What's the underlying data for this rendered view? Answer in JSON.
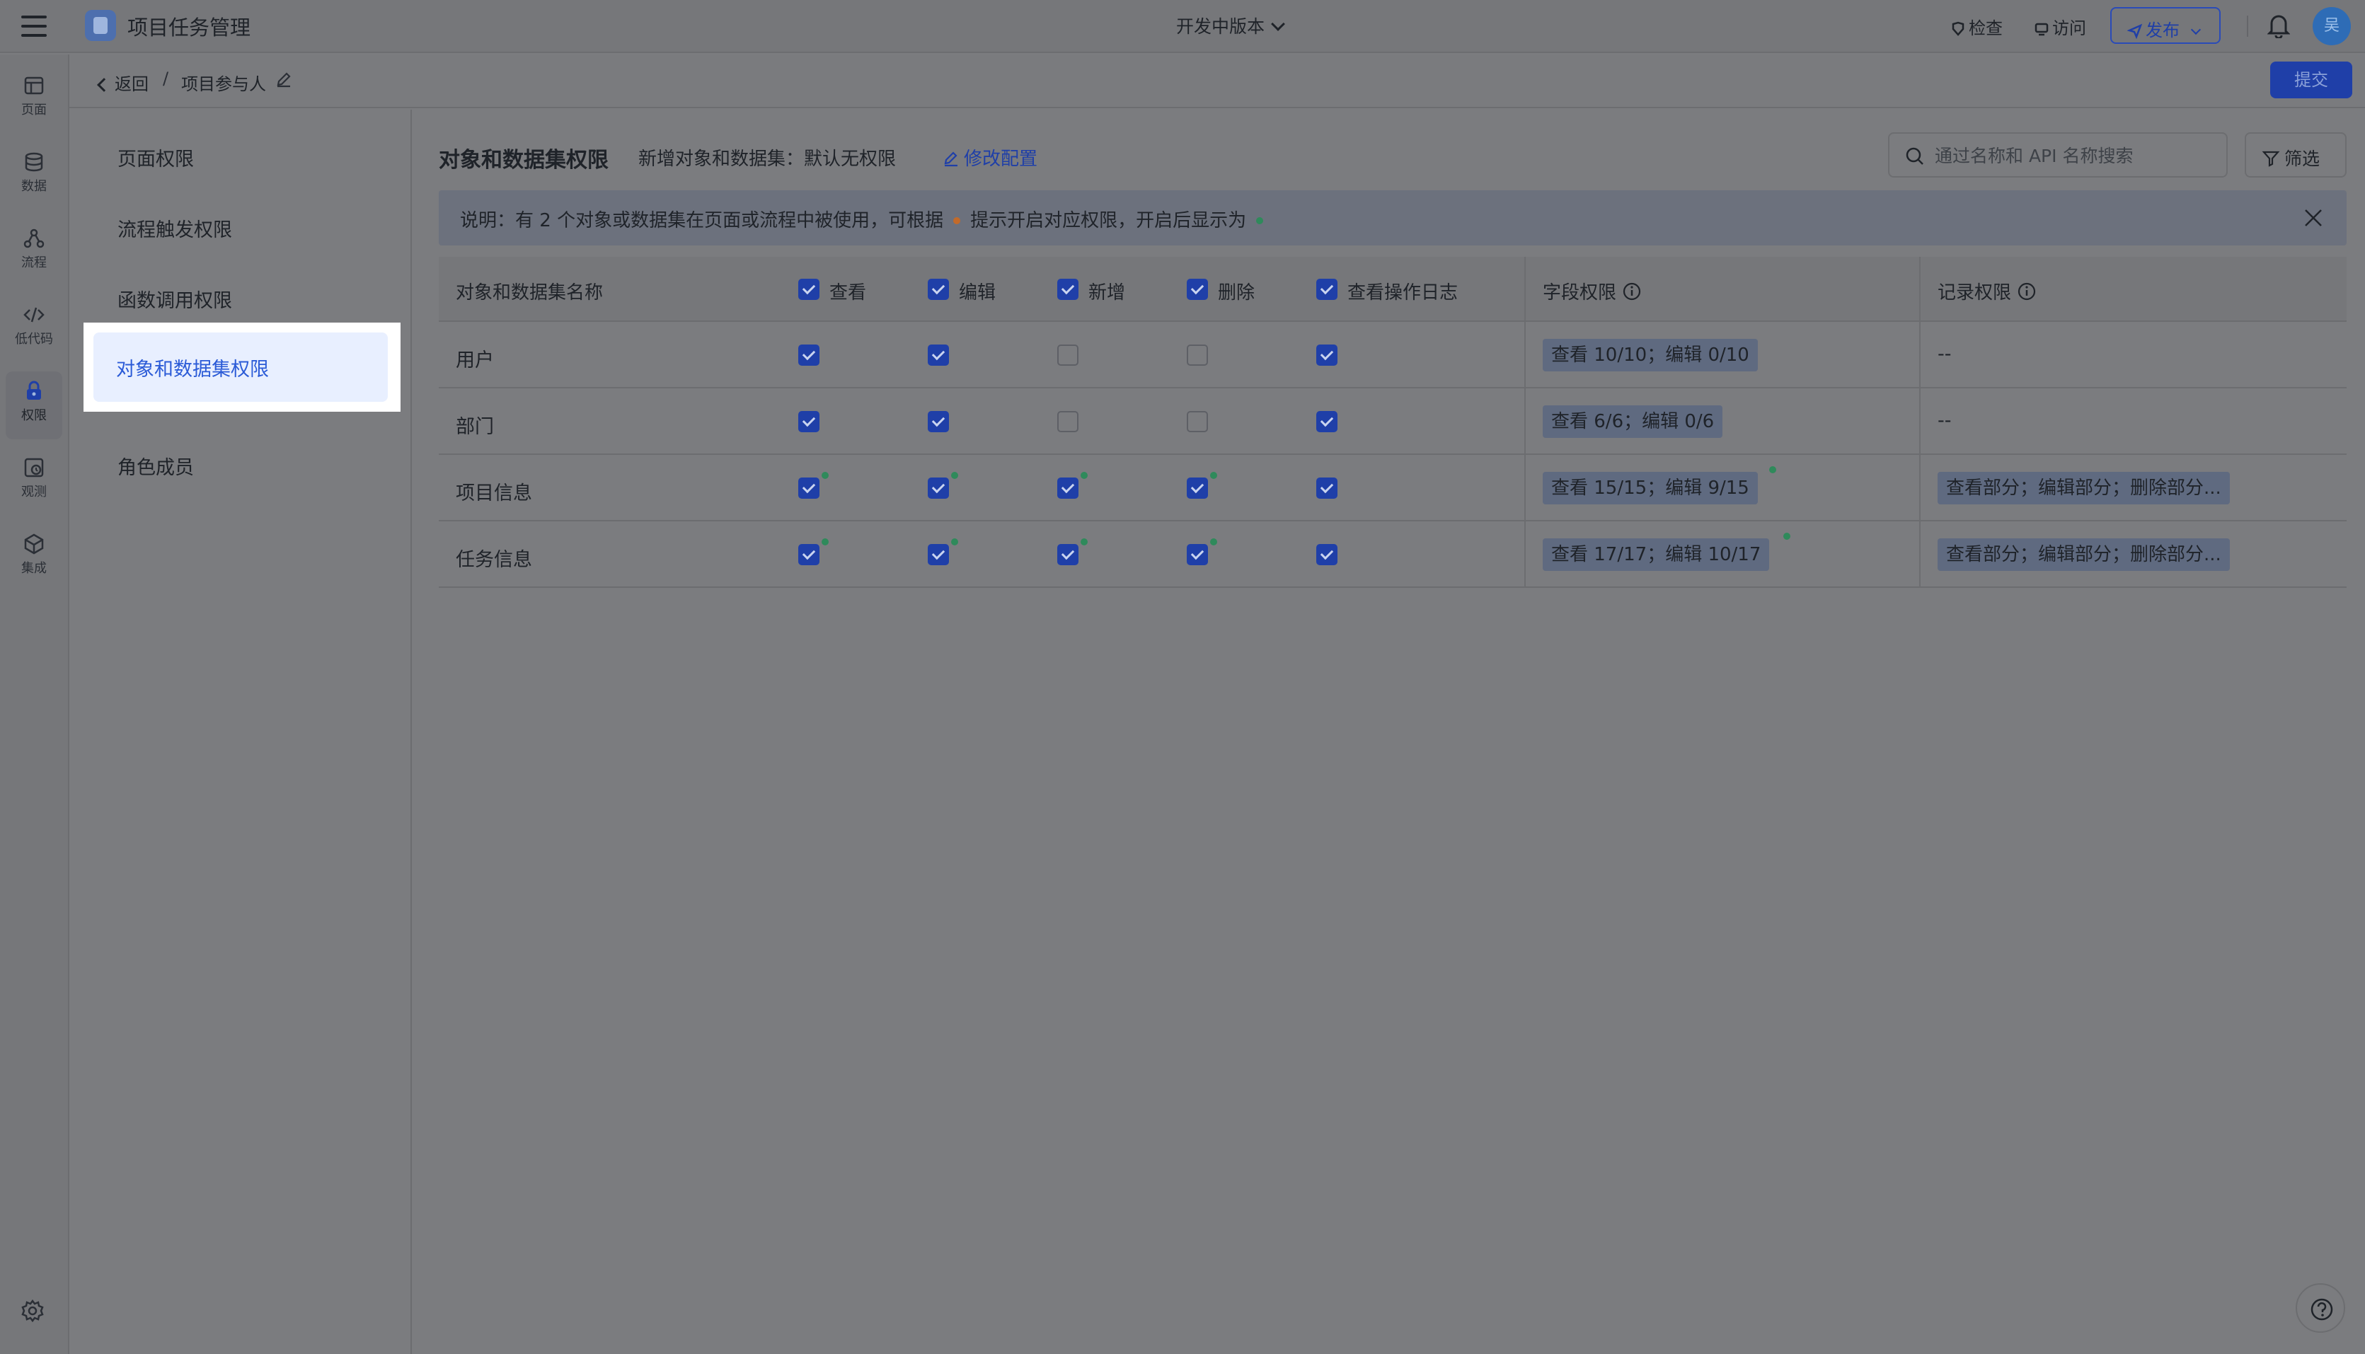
{
  "header": {
    "app_title": "项目任务管理",
    "version_label": "开发中版本",
    "check_label": "检查",
    "visit_label": "访问",
    "publish_label": "发布",
    "avatar_text": "吴"
  },
  "rail": {
    "items": [
      {
        "label": "页面",
        "icon": "page-icon"
      },
      {
        "label": "数据",
        "icon": "database-icon"
      },
      {
        "label": "流程",
        "icon": "flow-icon"
      },
      {
        "label": "低代码",
        "icon": "code-icon"
      },
      {
        "label": "权限",
        "icon": "lock-icon",
        "active": true
      },
      {
        "label": "观测",
        "icon": "monitor-icon"
      },
      {
        "label": "集成",
        "icon": "integration-icon"
      }
    ]
  },
  "breadcrumb": {
    "back_label": "返回",
    "separator": "/",
    "current": "项目参与人",
    "submit_label": "提交"
  },
  "submenu": {
    "items": [
      "页面权限",
      "流程触发权限",
      "函数调用权限",
      "对象和数据集权限",
      "角色成员"
    ],
    "active_index": 3
  },
  "section": {
    "title": "对象和数据集权限",
    "subtitle": "新增对象和数据集：默认无权限",
    "edit_label": "修改配置",
    "search_placeholder": "通过名称和 API 名称搜索",
    "filter_label": "筛选"
  },
  "notice": {
    "text_before": "说明：有 2 个对象或数据集在页面或流程中被使用，可根据",
    "text_middle": "提示开启对应权限，开启后显示为",
    "orange_color": "#c26a2a",
    "green_color": "#2f8a5b"
  },
  "table": {
    "columns": {
      "name": "对象和数据集名称",
      "view": "查看",
      "edit": "编辑",
      "create": "新增",
      "delete": "删除",
      "log": "查看操作日志",
      "field": "字段权限",
      "record": "记录权限"
    },
    "rows": [
      {
        "name": "用户",
        "field": "查看 10/10；编辑 0/10",
        "record": "--"
      },
      {
        "name": "部门",
        "field": "查看 6/6；编辑 0/6",
        "record": "--"
      },
      {
        "name": "项目信息",
        "field": "查看 15/15；编辑 9/15",
        "record": "查看部分；编辑部分；删除部分..."
      },
      {
        "name": "任务信息",
        "field": "查看 17/17；编辑 10/17",
        "record": "查看部分；编辑部分；删除部分..."
      }
    ]
  }
}
